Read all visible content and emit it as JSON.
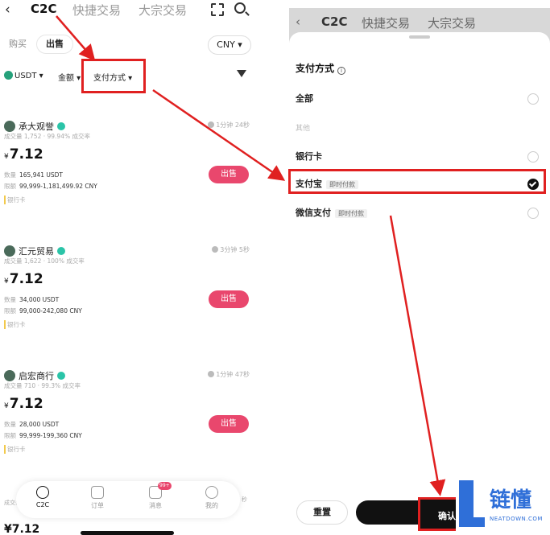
{
  "left": {
    "nav": {
      "back": "‹",
      "tabs": [
        "C2C",
        "快捷交易",
        "大宗交易"
      ]
    },
    "trade_tabs": {
      "buy": "购买",
      "sell": "出售"
    },
    "currency": "CNY ▾",
    "filters": {
      "coin": "USDT ▾",
      "amount": "金额 ▾",
      "payment": "支付方式 ▾"
    },
    "cards": [
      {
        "name": "承大观誉",
        "time": "1分钟 24秒",
        "stats": "成交量 1,752 · 99.94% 成交率",
        "price": "7.12",
        "qty_label": "数量",
        "qty": "165,941 USDT",
        "limit_label": "限额",
        "limit": "99,999-1,181,499.92 CNY",
        "payment": "银行卡",
        "button": "出售"
      },
      {
        "name": "汇元贸易",
        "time": "3分钟 5秒",
        "stats": "成交量 1,622 · 100% 成交率",
        "price": "7.12",
        "qty_label": "数量",
        "qty": "34,000 USDT",
        "limit_label": "限额",
        "limit": "99,000-242,080 CNY",
        "payment": "银行卡",
        "button": "出售"
      },
      {
        "name": "启宏商行",
        "time": "1分钟 47秒",
        "stats": "成交量 710 · 99.3% 成交率",
        "price": "7.12",
        "qty_label": "数量",
        "qty": "28,000 USDT",
        "limit_label": "限额",
        "limit": "99,999-199,360 CNY",
        "payment": "银行卡",
        "button": "出售"
      }
    ],
    "currency_symbol": "¥",
    "peek": {
      "stats": "成交么",
      "time": "秒",
      "price": "¥7.12"
    },
    "bottom_nav": [
      {
        "label": "C2C",
        "active": true
      },
      {
        "label": "订单",
        "active": false
      },
      {
        "label": "消息",
        "active": false,
        "badge": "99+"
      },
      {
        "label": "我的",
        "active": false
      }
    ]
  },
  "right": {
    "nav": {
      "back": "‹",
      "tabs": [
        "C2C",
        "快捷交易",
        "大宗交易"
      ]
    },
    "sheet": {
      "title": "支付方式",
      "info": "i",
      "options": [
        {
          "label": "全部",
          "tag": "",
          "selected": false
        },
        {
          "label": "银行卡",
          "tag": "",
          "selected": false
        },
        {
          "label": "支付宝",
          "tag": "即时付款",
          "selected": true
        },
        {
          "label": "微信支付",
          "tag": "即时付款",
          "selected": false
        }
      ],
      "other_label": "其他",
      "reset": "重置",
      "confirm": "确认"
    }
  },
  "watermark": {
    "brand": "链懂",
    "site": "NEATDOWN.COM"
  },
  "colors": {
    "highlight": "#e02020",
    "sell": "#e9476d",
    "brand": "#2f6fd8"
  }
}
